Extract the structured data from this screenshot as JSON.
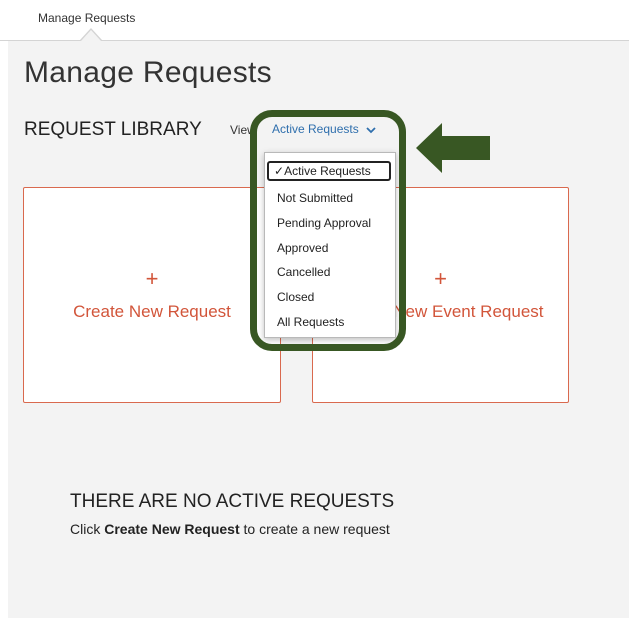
{
  "breadcrumb": {
    "current": "Manage Requests"
  },
  "page": {
    "title": "Manage Requests",
    "section_title": "REQUEST LIBRARY"
  },
  "view": {
    "label": "View",
    "selected": "Active Requests",
    "chevron_icon": "chevron-down-icon",
    "options": [
      "Active Requests",
      "Not Submitted",
      "Pending Approval",
      "Approved",
      "Cancelled",
      "Closed",
      "All Requests"
    ],
    "check_mark": "✓"
  },
  "cards": {
    "create": {
      "plus": "+",
      "label": "Create New Request"
    },
    "event": {
      "plus": "+",
      "label": "Create New Event Request"
    }
  },
  "empty_state": {
    "title": "THERE ARE NO ACTIVE REQUESTS",
    "prefix": "Click ",
    "bold": "Create New Request",
    "suffix": " to create a new request"
  },
  "colors": {
    "accent": "#d2553a",
    "link": "#2f6fad",
    "annotation": "#385723",
    "background": "#f3f3f3"
  }
}
